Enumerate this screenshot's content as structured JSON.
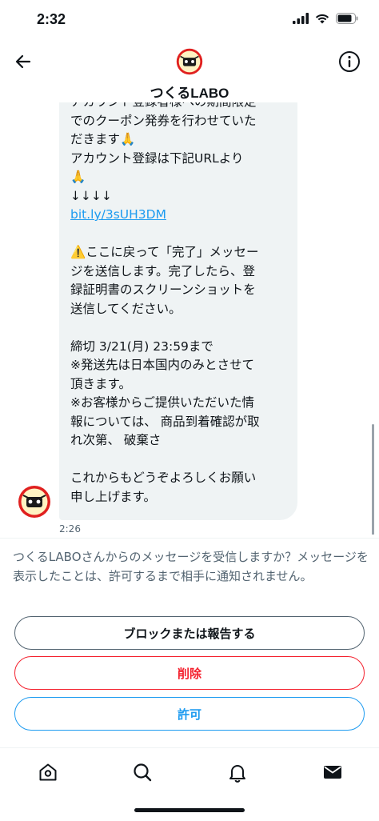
{
  "status": {
    "time": "2:32"
  },
  "header": {
    "title": "つくるLABO",
    "back_icon": "arrow-left-icon",
    "info_icon": "info-icon"
  },
  "message": {
    "line_a": "アカウント登録者様への期間限定\nでのクーポン発券を行わせていた\nだきます🙏\nアカウント登録は下記URLより\n🙏\n↓↓↓↓",
    "link": "bit.ly/3sUH3DM",
    "line_b": "⚠️ここに戻って「完了」メッセー\nジを送信します。完了したら、登\n録証明書のスクリーンショットを\n送信してください。",
    "line_c": "締切 3/21(月) 23:59まで\n※発送先は日本国内のみとさせて\n頂きます。\n※お客様からご提供いただいた情\n報については、 商品到着確認が取\nれ次第、 破棄さ",
    "line_d": "これからもどうぞよろしくお願い\n申し上げます。",
    "time": "2:26"
  },
  "request": {
    "text": "つくるLABOさんからのメッセージを受信しますか？メッセージを表示したことは、許可するまで相手に通知されません。",
    "block_label": "ブロックまたは報告する",
    "delete_label": "削除",
    "allow_label": "許可"
  },
  "colors": {
    "accent": "#1d9bf0",
    "danger": "#f4212e",
    "bubble": "#eff3f4",
    "secondary_text": "#536471"
  },
  "tabs": [
    "home-icon",
    "search-icon",
    "bell-icon",
    "mail-icon"
  ]
}
